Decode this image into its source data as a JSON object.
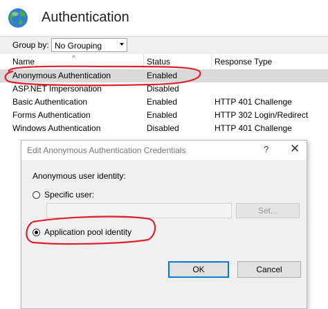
{
  "header": {
    "title": "Authentication",
    "icon": "globe-icon"
  },
  "toolbar": {
    "group_by_label": "Group by:",
    "group_by_value": "No Grouping"
  },
  "table": {
    "columns": [
      "Name",
      "Status",
      "Response Type"
    ],
    "rows": [
      {
        "name": "Anonymous Authentication",
        "status": "Enabled",
        "response": ""
      },
      {
        "name": "ASP.NET Impersonation",
        "status": "Disabled",
        "response": ""
      },
      {
        "name": "Basic Authentication",
        "status": "Enabled",
        "response": "HTTP 401 Challenge"
      },
      {
        "name": "Forms Authentication",
        "status": "Enabled",
        "response": "HTTP 302 Login/Redirect"
      },
      {
        "name": "Windows Authentication",
        "status": "Disabled",
        "response": "HTTP 401 Challenge"
      }
    ]
  },
  "dialog": {
    "title": "Edit Anonymous Authentication Credentials",
    "help": "?",
    "close": "✕",
    "identity_label": "Anonymous user identity:",
    "specific_user_label": "Specific user:",
    "specific_user_value": "",
    "set_button": "Set...",
    "pool_identity_label": "Application pool identity",
    "ok_button": "OK",
    "cancel_button": "Cancel"
  },
  "colors": {
    "annotation": "#e0202a",
    "selection": "#d9d9d9",
    "focus": "#0078d7"
  }
}
